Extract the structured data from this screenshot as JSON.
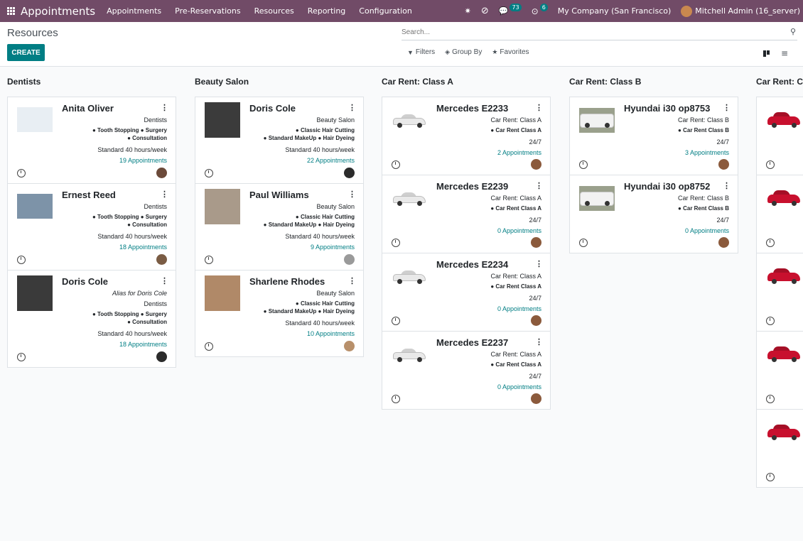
{
  "navbar": {
    "brand": "Appointments",
    "menu": [
      "Appointments",
      "Pre-Reservations",
      "Resources",
      "Reporting",
      "Configuration"
    ],
    "messages_count": "73",
    "activities_count": "6",
    "company": "My Company (San Francisco)",
    "user": "Mitchell Admin (16_server)"
  },
  "control_panel": {
    "title": "Resources",
    "create_label": "CREATE",
    "search_placeholder": "Search...",
    "filters_label": "Filters",
    "groupby_label": "Group By",
    "favorites_label": "Favorites"
  },
  "colors": {
    "navbar": "#714b67",
    "primary": "#017e84"
  },
  "columns": [
    {
      "title": "Dentists",
      "cards": [
        {
          "name": "Anita Oliver",
          "type": "Dentists",
          "tags1": "● Tooth Stopping ● Surgery",
          "tags2": "● Consultation",
          "hours": "Standard 40 hours/week",
          "appointments": "19 Appointments"
        },
        {
          "name": "Ernest Reed",
          "type": "Dentists",
          "tags1": "● Tooth Stopping ● Surgery",
          "tags2": "● Consultation",
          "hours": "Standard 40 hours/week",
          "appointments": "18 Appointments"
        },
        {
          "name": "Doris Cole",
          "alias": "Alias for Doris Cole",
          "type": "Dentists",
          "tags1": "● Tooth Stopping ● Surgery",
          "tags2": "● Consultation",
          "hours": "Standard 40 hours/week",
          "appointments": "18 Appointments"
        }
      ]
    },
    {
      "title": "Beauty Salon",
      "cards": [
        {
          "name": "Doris Cole",
          "type": "Beauty Salon",
          "tags1": "● Classic Hair Cutting",
          "tags2": "● Standard MakeUp ● Hair Dyeing",
          "hours": "Standard 40 hours/week",
          "appointments": "22 Appointments"
        },
        {
          "name": "Paul Williams",
          "type": "Beauty Salon",
          "tags1": "● Classic Hair Cutting",
          "tags2": "● Standard MakeUp ● Hair Dyeing",
          "hours": "Standard 40 hours/week",
          "appointments": "9 Appointments"
        },
        {
          "name": "Sharlene Rhodes",
          "type": "Beauty Salon",
          "tags1": "● Classic Hair Cutting",
          "tags2": "● Standard MakeUp ● Hair Dyeing",
          "hours": "Standard 40 hours/week",
          "appointments": "10 Appointments"
        }
      ]
    },
    {
      "title": "Car Rent: Class A",
      "cards": [
        {
          "name": "Mercedes E2233",
          "type": "Car Rent: Class A",
          "tag": "● Car Rent Class A",
          "hours": "24/7",
          "appointments": "2 Appointments"
        },
        {
          "name": "Mercedes E2239",
          "type": "Car Rent: Class A",
          "tag": "● Car Rent Class A",
          "hours": "24/7",
          "appointments": "0 Appointments"
        },
        {
          "name": "Mercedes E2234",
          "type": "Car Rent: Class A",
          "tag": "● Car Rent Class A",
          "hours": "24/7",
          "appointments": "0 Appointments"
        },
        {
          "name": "Mercedes E2237",
          "type": "Car Rent: Class A",
          "tag": "● Car Rent Class A",
          "hours": "24/7",
          "appointments": "0 Appointments"
        }
      ]
    },
    {
      "title": "Car Rent: Class B",
      "cards": [
        {
          "name": "Hyundai i30 op8753",
          "type": "Car Rent: Class B",
          "tag": "● Car Rent Class B",
          "hours": "24/7",
          "appointments": "3 Appointments"
        },
        {
          "name": "Hyundai i30 op8752",
          "type": "Car Rent: Class B",
          "tag": "● Car Rent Class B",
          "hours": "24/7",
          "appointments": "0 Appointments"
        }
      ]
    },
    {
      "title": "Car Rent: Cl"
    }
  ]
}
